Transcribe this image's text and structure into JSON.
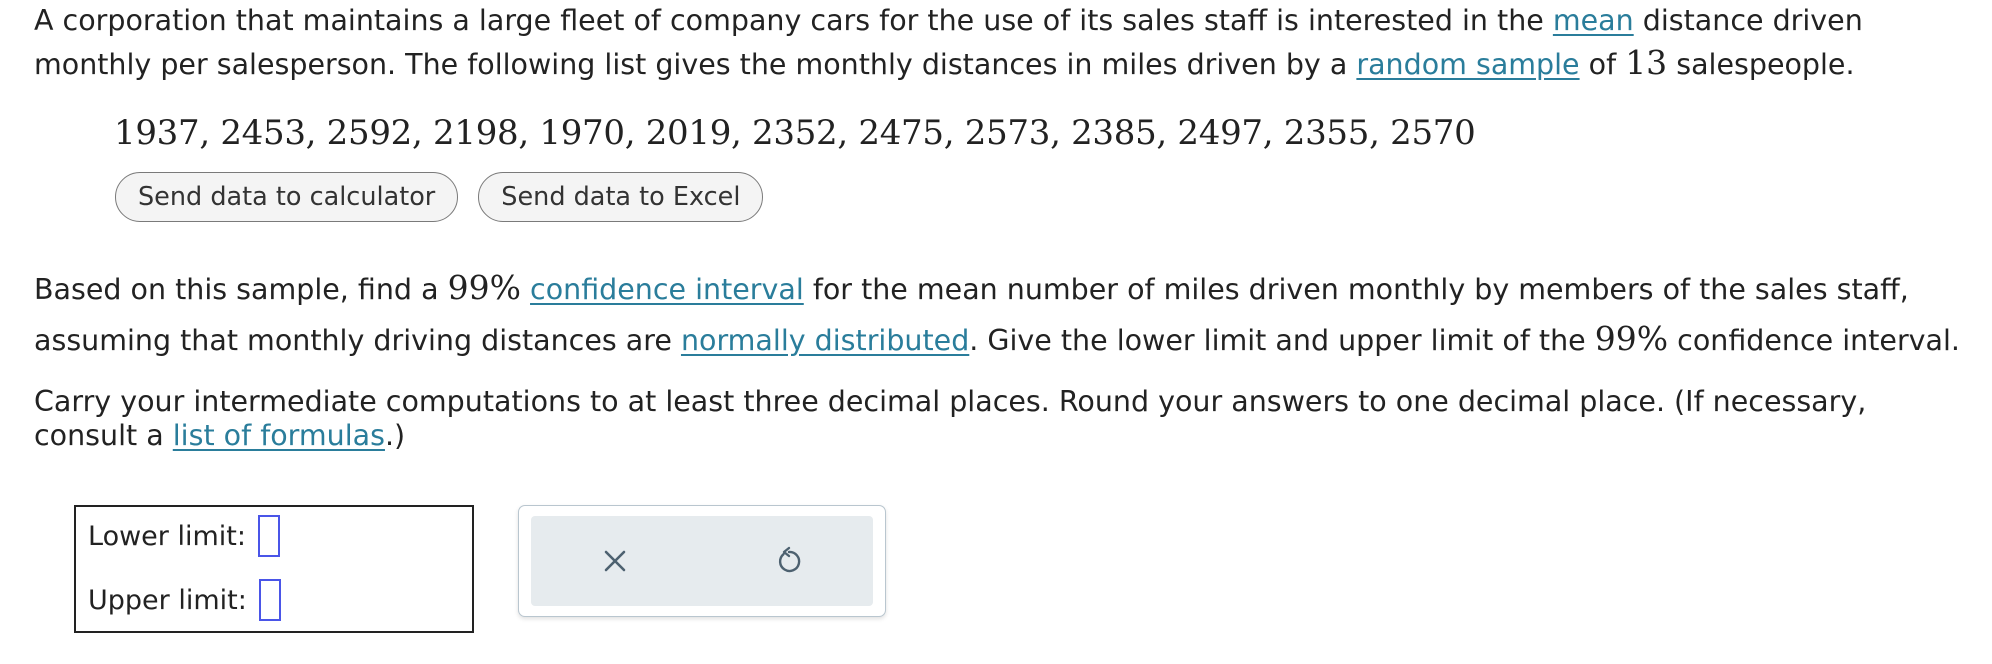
{
  "intro": {
    "t1": "A corporation that maintains a large fleet of company cars for the use of its sales staff is interested in the ",
    "link_mean": "mean",
    "t2": " distance driven monthly per salesperson. The following list gives the monthly distances in miles driven by a ",
    "link_random_sample": "random sample",
    "t3": " of ",
    "n": "13",
    "t4": " salespeople."
  },
  "data_values": "1937, 2453, 2592, 2198, 1970, 2019, 2352, 2475, 2573, 2385, 2497, 2355, 2570",
  "buttons": {
    "calculator": "Send data to calculator",
    "excel": "Send data to Excel"
  },
  "question": {
    "t1": "Based on this sample, find a ",
    "pct1": "99%",
    "t2": " ",
    "link_ci": "confidence interval",
    "t3": " for the mean number of miles driven monthly by members of the sales staff, assuming that monthly driving distances are ",
    "link_normal": "normally distributed",
    "t4": ". Give the lower limit and upper limit of the ",
    "pct2": "99%",
    "t5": " confidence interval."
  },
  "instructions": {
    "t1": "Carry your intermediate computations to at least three decimal places. Round your answers to one decimal place. (If necessary, consult a ",
    "link_formulas": "list of formulas",
    "t2": ".)"
  },
  "answer": {
    "lower_label": "Lower limit:",
    "lower_value": "",
    "upper_label": "Upper limit:",
    "upper_value": ""
  },
  "tools": {
    "clear_icon": "close-icon",
    "undo_icon": "undo-icon"
  },
  "colors": {
    "link": "#2a7d9b",
    "answer_slot_border": "#4a55e8",
    "tools_bg": "#e6ebee"
  }
}
